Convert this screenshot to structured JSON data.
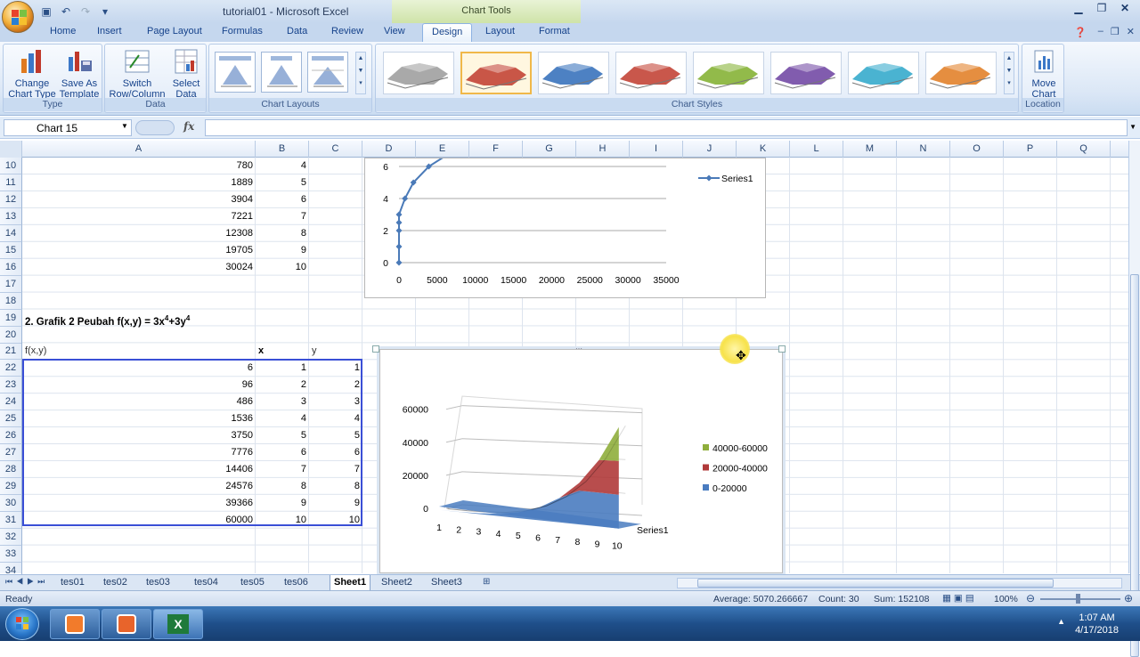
{
  "window": {
    "title": "tutorial01 - Microsoft Excel",
    "context_tab_title": "Chart Tools"
  },
  "tabs": [
    "Home",
    "Insert",
    "Page Layout",
    "Formulas",
    "Data",
    "Review",
    "View",
    "Design",
    "Layout",
    "Format"
  ],
  "active_tab": "Design",
  "ribbon": {
    "type_group": {
      "label": "Type",
      "change_chart_type": "Change Chart Type",
      "change_1": "Change",
      "change_2": "Chart Type",
      "save_1": "Save As",
      "save_2": "Template"
    },
    "data_group": {
      "label": "Data",
      "switch_1": "Switch",
      "switch_2": "Row/Column",
      "select_1": "Select",
      "select_2": "Data"
    },
    "layouts_group": {
      "label": "Chart Layouts"
    },
    "styles_group": {
      "label": "Chart Styles",
      "style_colors": [
        "#9a9a9a",
        "#c0392b",
        "#2e6bb8",
        "#c0392b",
        "#7fae2a",
        "#6b3fa0",
        "#2aa6c9",
        "#e07a1f"
      ]
    },
    "location_group": {
      "label": "Location",
      "move_1": "Move",
      "move_2": "Chart"
    }
  },
  "formula_bar": {
    "name_box": "Chart 15",
    "fx": "fx",
    "formula": ""
  },
  "columns": [
    "A",
    "B",
    "C",
    "D",
    "E",
    "F",
    "G",
    "H",
    "I",
    "J",
    "K",
    "L",
    "M",
    "N",
    "O",
    "P",
    "Q"
  ],
  "rows": [
    "10",
    "11",
    "12",
    "13",
    "14",
    "15",
    "16",
    "17",
    "18",
    "19",
    "20",
    "21",
    "22",
    "23",
    "24",
    "25",
    "26",
    "27",
    "28",
    "29",
    "30",
    "31",
    "32",
    "33",
    "34"
  ],
  "table1": {
    "a": [
      "780",
      "1889",
      "3904",
      "7221",
      "12308",
      "19705",
      "30024"
    ],
    "b": [
      "4",
      "5",
      "6",
      "7",
      "8",
      "9",
      "10"
    ]
  },
  "heading": {
    "text": "2. Grafik 2 Peubah f(x,y) = 3x",
    "sup1": "4",
    "mid": "+3y",
    "sup2": "4"
  },
  "table2": {
    "headers": {
      "a": "f(x,y)",
      "b": "x",
      "c": "y"
    },
    "a": [
      "6",
      "96",
      "486",
      "1536",
      "3750",
      "7776",
      "14406",
      "24576",
      "39366",
      "60000"
    ],
    "b": [
      "1",
      "2",
      "3",
      "4",
      "5",
      "6",
      "7",
      "8",
      "9",
      "10"
    ],
    "c": [
      "1",
      "2",
      "3",
      "4",
      "5",
      "6",
      "7",
      "8",
      "9",
      "10"
    ]
  },
  "chart_data": [
    {
      "type": "scatter",
      "title": "",
      "x": [
        0,
        0,
        0,
        0,
        0,
        0,
        0,
        780,
        1889,
        3904,
        7221
      ],
      "y": [
        0,
        1,
        2,
        3,
        4,
        5,
        6,
        4,
        5,
        6,
        7
      ],
      "series": [
        {
          "name": "Series1",
          "x": [
            0,
            0,
            0,
            0,
            0,
            780,
            1889,
            3904,
            7221
          ],
          "y": [
            0,
            1,
            2,
            2.5,
            3,
            4,
            5,
            6,
            7
          ]
        }
      ],
      "xticks": [
        "0",
        "5000",
        "10000",
        "15000",
        "20000",
        "25000",
        "30000",
        "35000"
      ],
      "yticks": [
        "0",
        "2",
        "4",
        "6"
      ],
      "xlim": [
        0,
        35000
      ],
      "ylim": [
        0,
        6
      ],
      "legend": "right",
      "grid": true
    },
    {
      "type": "area",
      "subtype": "3d-surface",
      "categories": [
        "1",
        "2",
        "3",
        "4",
        "5",
        "6",
        "7",
        "8",
        "9",
        "10"
      ],
      "series": [
        {
          "name": "Series1",
          "values": [
            6,
            96,
            486,
            1536,
            3750,
            7776,
            14406,
            24576,
            39366,
            60000
          ]
        }
      ],
      "bands": [
        {
          "name": "40000-60000",
          "color": "#8fae3c"
        },
        {
          "name": "20000-40000",
          "color": "#b03a3a"
        },
        {
          "name": "0-20000",
          "color": "#4a7cc0"
        }
      ],
      "yticks": [
        "0",
        "20000",
        "40000",
        "60000"
      ],
      "ylim": [
        0,
        60000
      ],
      "legend": "right"
    }
  ],
  "sheet_tabs": [
    "tes01",
    "tes02",
    "tes03",
    "tes04",
    "tes05",
    "tes06",
    "Sheet1",
    "Sheet2",
    "Sheet3"
  ],
  "active_sheet": "Sheet1",
  "status": {
    "ready": "Ready",
    "average": "Average: 5070.266667",
    "count": "Count: 30",
    "sum": "Sum: 152108",
    "zoom": "100%"
  },
  "taskbar": {
    "time": "1:07 AM",
    "date": "4/17/2018"
  }
}
